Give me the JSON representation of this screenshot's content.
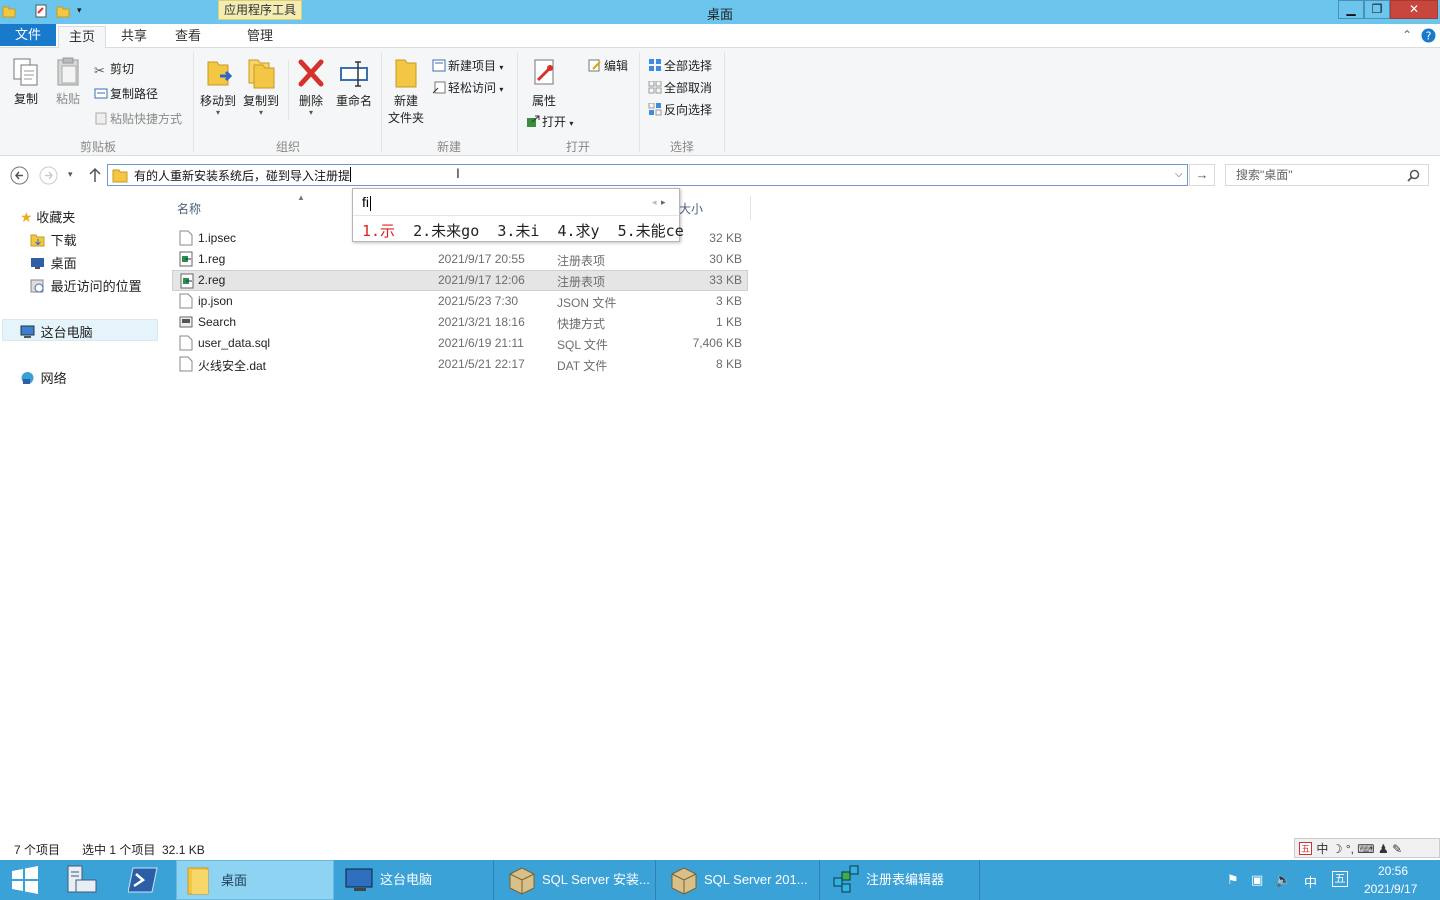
{
  "window": {
    "title": "桌面",
    "context_tab": "应用程序工具",
    "min": "▁",
    "restore": "❐",
    "close": "✕"
  },
  "tabs": {
    "file": "文件",
    "home": "主页",
    "share": "共享",
    "view": "查看",
    "manage": "管理"
  },
  "ribbon": {
    "copy": "复制",
    "paste": "粘贴",
    "cut": "剪切",
    "copy_path": "复制路径",
    "paste_shortcut": "粘贴快捷方式",
    "move_to": "移动到",
    "copy_to": "复制到",
    "delete": "删除",
    "rename": "重命名",
    "new_folder_1": "新建",
    "new_folder_2": "文件夹",
    "new_item": "新建项目",
    "easy_access": "轻松访问",
    "properties": "属性",
    "open": "打开",
    "edit": "编辑",
    "select_all": "全部选择",
    "select_none": "全部取消",
    "invert_selection": "反向选择",
    "groups": {
      "clipboard": "剪贴板",
      "organize": "组织",
      "new": "新建",
      "open": "打开",
      "select": "选择"
    }
  },
  "address": {
    "text": "有的人重新安装系统后，碰到导入注册提",
    "search_placeholder": "搜索\"桌面\""
  },
  "ime": {
    "input": "fi",
    "candidates": [
      "1.示",
      "2.未来go",
      "3.未i",
      "4.求y",
      "5.未能ce"
    ]
  },
  "nav": {
    "favorites": "收藏夹",
    "downloads": "下载",
    "desktop": "桌面",
    "recent": "最近访问的位置",
    "this_pc": "这台电脑",
    "network": "网络"
  },
  "columns": {
    "name": "名称",
    "size": "大小"
  },
  "files": [
    {
      "name": "1.ipsec",
      "date": "",
      "type": "",
      "size": "32 KB"
    },
    {
      "name": "1.reg",
      "date": "2021/9/17 20:55",
      "type": "注册表项",
      "size": "30 KB"
    },
    {
      "name": "2.reg",
      "date": "2021/9/17 12:06",
      "type": "注册表项",
      "size": "33 KB"
    },
    {
      "name": "ip.json",
      "date": "2021/5/23 7:30",
      "type": "JSON 文件",
      "size": "3 KB"
    },
    {
      "name": "Search",
      "date": "2021/3/21 18:16",
      "type": "快捷方式",
      "size": "1 KB"
    },
    {
      "name": "user_data.sql",
      "date": "2021/6/19 21:11",
      "type": "SQL 文件",
      "size": "7,406 KB"
    },
    {
      "name": "火线安全.dat",
      "date": "2021/5/21 22:17",
      "type": "DAT 文件",
      "size": "8 KB"
    }
  ],
  "status": {
    "count": "7 个项目",
    "selected": "选中 1 个项目  32.1 KB"
  },
  "taskbar": {
    "items": [
      "桌面",
      "这台电脑",
      "SQL Server 安装...",
      "SQL Server 201...",
      "注册表编辑器"
    ],
    "time": "20:56",
    "date": "2021/9/17",
    "ime_lang": "中",
    "ime_mode": "五"
  },
  "langbar": [
    "中",
    "☽",
    "°,",
    "⌨",
    "♟",
    "✎"
  ]
}
